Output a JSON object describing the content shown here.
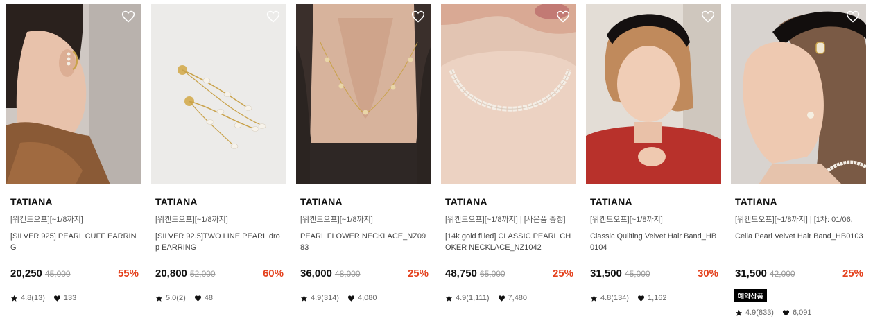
{
  "products": [
    {
      "brand": "TATIANA",
      "promo": "[위캔드오프][~1/8까지]",
      "name": "[SILVER 925] PEARL CUFF EARRING",
      "price": "20,250",
      "original_price": "45,000",
      "discount": "55%",
      "rating": "4.8(13)",
      "likes": "133",
      "badge": "",
      "image": "woman-ear-pearl-cuff-earring-photo"
    },
    {
      "brand": "TATIANA",
      "promo": "[위캔드오프][~1/8까지]",
      "name": "[SILVER 92.5]TWO LINE PEARL drop EARRING",
      "price": "20,800",
      "original_price": "52,000",
      "discount": "60%",
      "rating": "5.0(2)",
      "likes": "48",
      "badge": "",
      "image": "gold-pearl-drop-earrings-photo"
    },
    {
      "brand": "TATIANA",
      "promo": "[위캔드오프][~1/8까지]",
      "name": "PEARL FLOWER NECKLACE_NZ0983",
      "price": "36,000",
      "original_price": "48,000",
      "discount": "25%",
      "rating": "4.9(314)",
      "likes": "4,080",
      "badge": "",
      "image": "woman-neck-flower-necklace-photo"
    },
    {
      "brand": "TATIANA",
      "promo": "[위캔드오프][~1/8까지] | [사은품 증정]",
      "name": "[14k gold filled] CLASSIC PEARL CHOKER NECKLACE_NZ1042",
      "price": "48,750",
      "original_price": "65,000",
      "discount": "25%",
      "rating": "4.9(1,111)",
      "likes": "7,480",
      "badge": "",
      "image": "woman-pearl-choker-photo"
    },
    {
      "brand": "TATIANA",
      "promo": "[위캔드오프][~1/8까지]",
      "name": "Classic Quilting Velvet Hair Band_HB0104",
      "price": "31,500",
      "original_price": "45,000",
      "discount": "30%",
      "rating": "4.8(134)",
      "likes": "1,162",
      "badge": "",
      "image": "woman-velvet-hairband-red-sweater-photo"
    },
    {
      "brand": "TATIANA",
      "promo": "[위캔드오프][~1/8까지] | [1차: 01/06,",
      "name": "Celia Pearl Velvet Hair Band_HB0103",
      "price": "31,500",
      "original_price": "42,000",
      "discount": "25%",
      "rating": "4.9(833)",
      "likes": "6,091",
      "badge": "예약상품",
      "image": "woman-pearl-velvet-hairband-photo"
    }
  ],
  "icons": {
    "wishlist": "heart-outline-icon",
    "rating": "star-icon",
    "likes": "heart-filled-icon"
  },
  "colors": {
    "discount": "#e4411d",
    "badge_bg": "#000000"
  }
}
